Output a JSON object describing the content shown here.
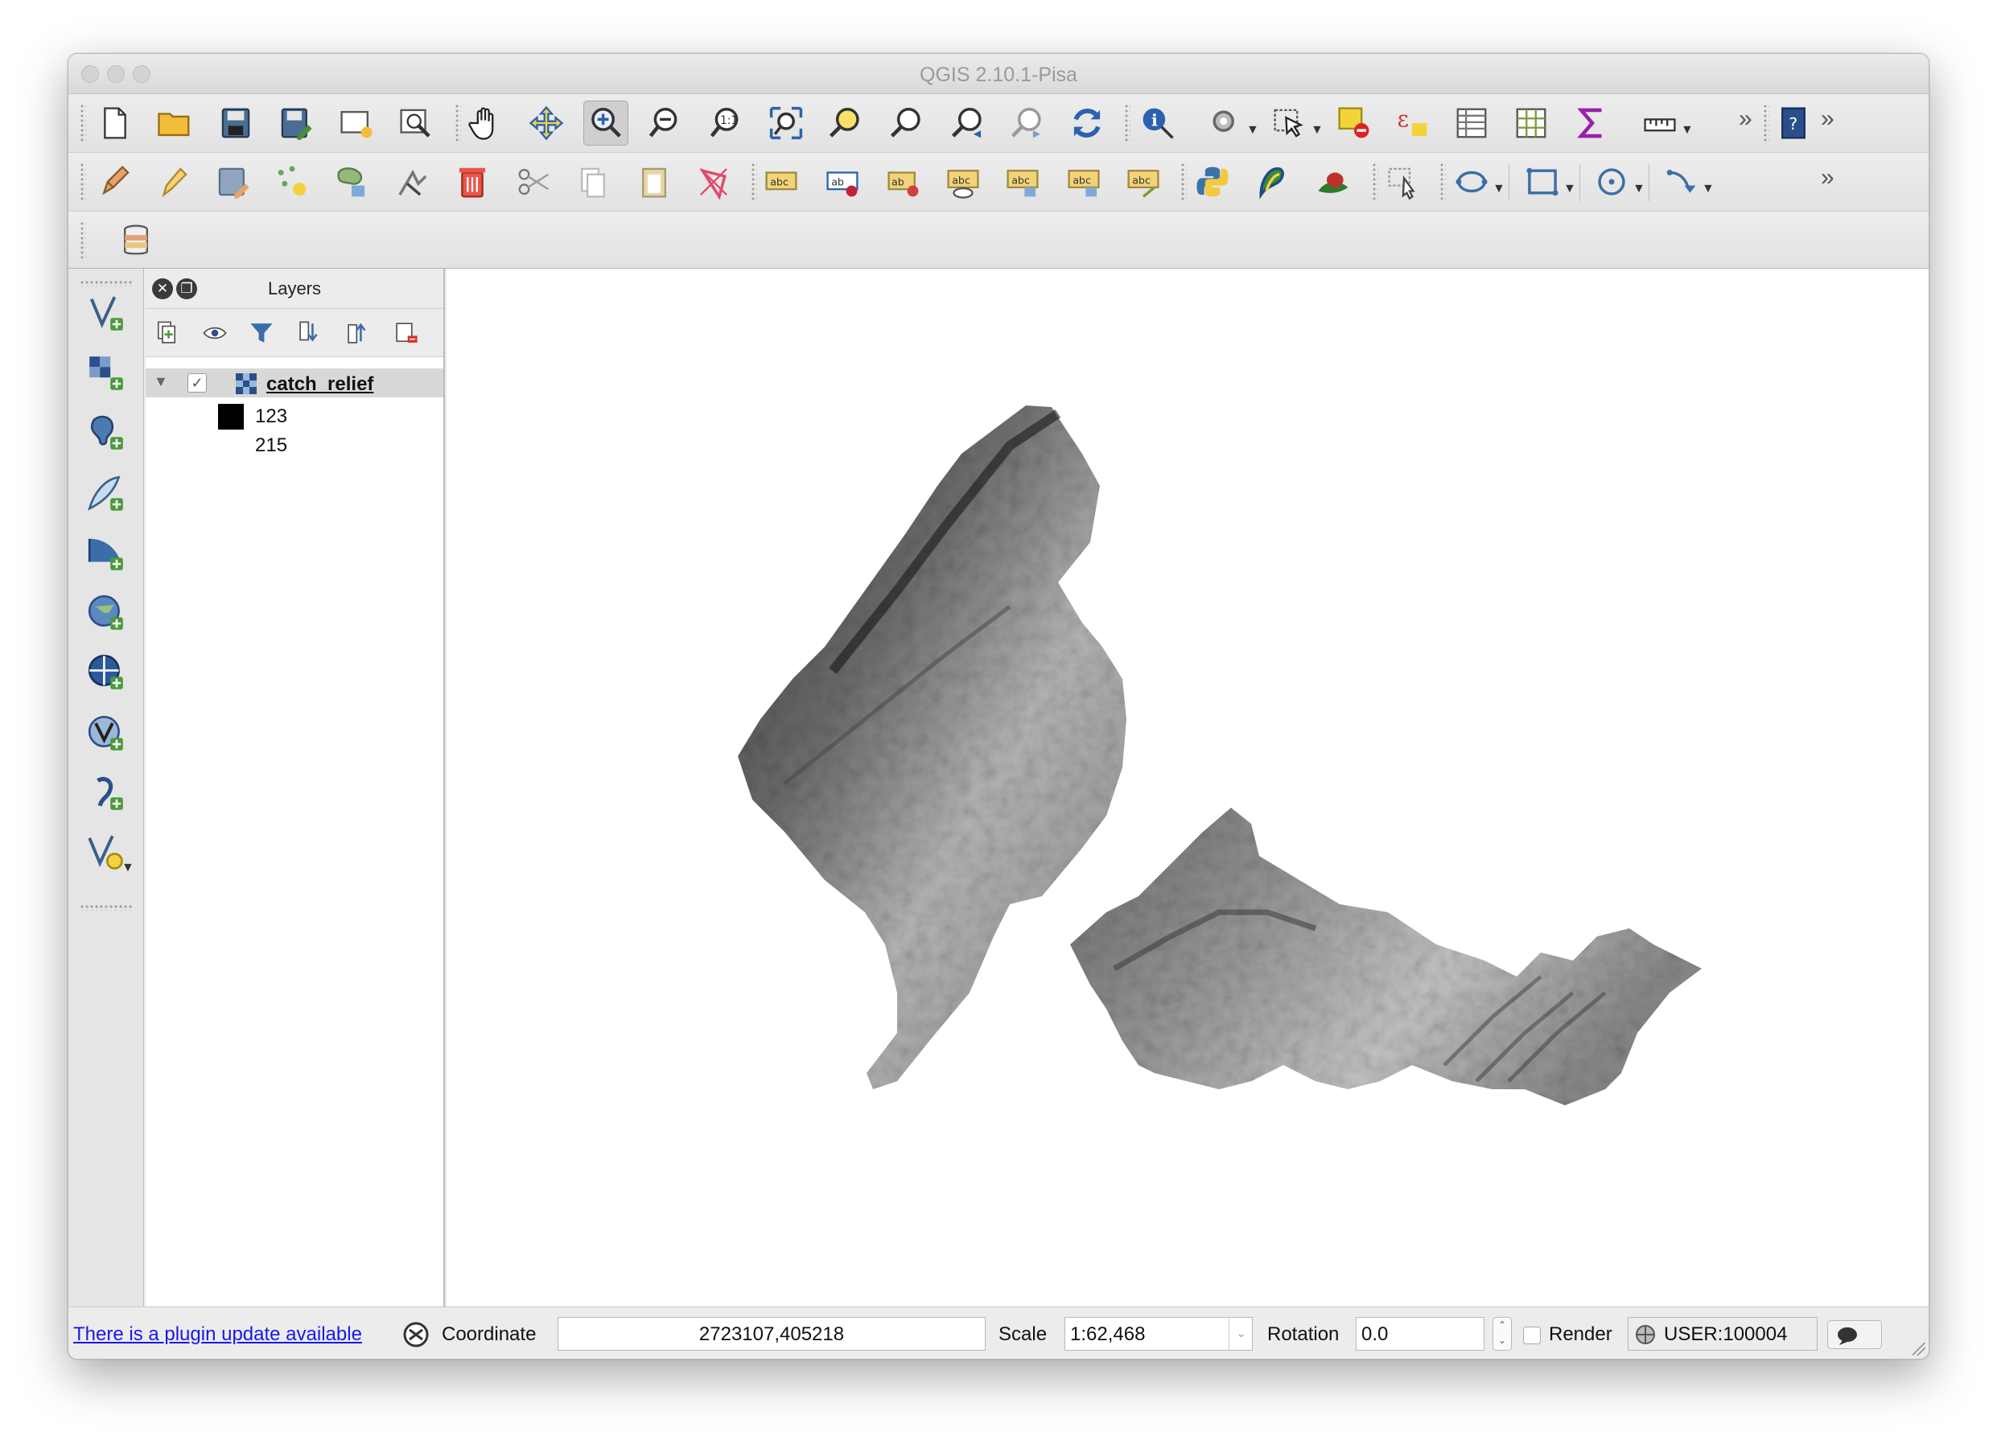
{
  "window": {
    "title": "QGIS 2.10.1-Pisa"
  },
  "toolbar": {
    "row1": [
      "new-project-icon",
      "open-project-icon",
      "save-project-icon",
      "save-as-icon",
      "new-print-composer-icon",
      "composer-manager-icon",
      "pan-hand-icon",
      "pan-to-selection-icon",
      "zoom-in-icon",
      "zoom-out-icon",
      "zoom-actual-size-icon",
      "zoom-full-icon",
      "zoom-to-selection-icon",
      "zoom-to-layer-icon",
      "zoom-last-icon",
      "zoom-next-icon",
      "refresh-icon",
      "identify-icon",
      "run-action-icon",
      "select-features-icon",
      "deselect-icon",
      "expression-select-icon",
      "attribute-table-icon",
      "field-calculator-icon",
      "statistics-sigma-icon",
      "measure-ruler-icon",
      "more-chevron-icon",
      "help-icon"
    ],
    "row2": [
      "edits-pencil-icon",
      "toggle-editing-icon",
      "save-edits-icon",
      "add-feature-icon",
      "move-feature-icon",
      "node-tool-icon",
      "delete-selected-icon",
      "cut-features-icon",
      "copy-features-icon",
      "paste-features-icon",
      "digitize-delete-icon",
      "label-icon",
      "pin-label-icon",
      "show-hide-label-icon",
      "highlight-label-icon",
      "move-label-icon",
      "rotate-label-icon",
      "change-label-icon",
      "python-console-icon",
      "gps-icon",
      "heatmap-icon",
      "select-pointer-icon",
      "circle-tool-icon",
      "rectangle-tool-icon",
      "ellipse-tool-icon",
      "trace-tool-icon",
      "more-chevron-icon"
    ],
    "row3": [
      "database-icon"
    ],
    "more_label": "»"
  },
  "left_tools": [
    "add-vector-layer-icon",
    "add-raster-layer-icon",
    "add-postgis-layer-icon",
    "new-shapefile-icon",
    "add-spatialite-layer-icon",
    "add-wms-layer-icon",
    "add-wcs-layer-icon",
    "add-wfs-layer-icon",
    "add-delimited-text-icon",
    "new-virtual-layer-icon"
  ],
  "layers_panel": {
    "title": "Layers",
    "layer": {
      "name": "catch_relief",
      "checked": true
    },
    "legend": [
      {
        "label": "123",
        "color": "#000000"
      },
      {
        "label": "215",
        "color": "#ffffff"
      }
    ]
  },
  "statusbar": {
    "plugin_link": "There is a plugin update available",
    "coordinate_label": "Coordinate",
    "coordinate_value": "2723107,405218",
    "scale_label": "Scale",
    "scale_value": "1:62,468",
    "rotation_label": "Rotation",
    "rotation_value": "0.0",
    "render_label": "Render",
    "crs": "USER:100004"
  }
}
